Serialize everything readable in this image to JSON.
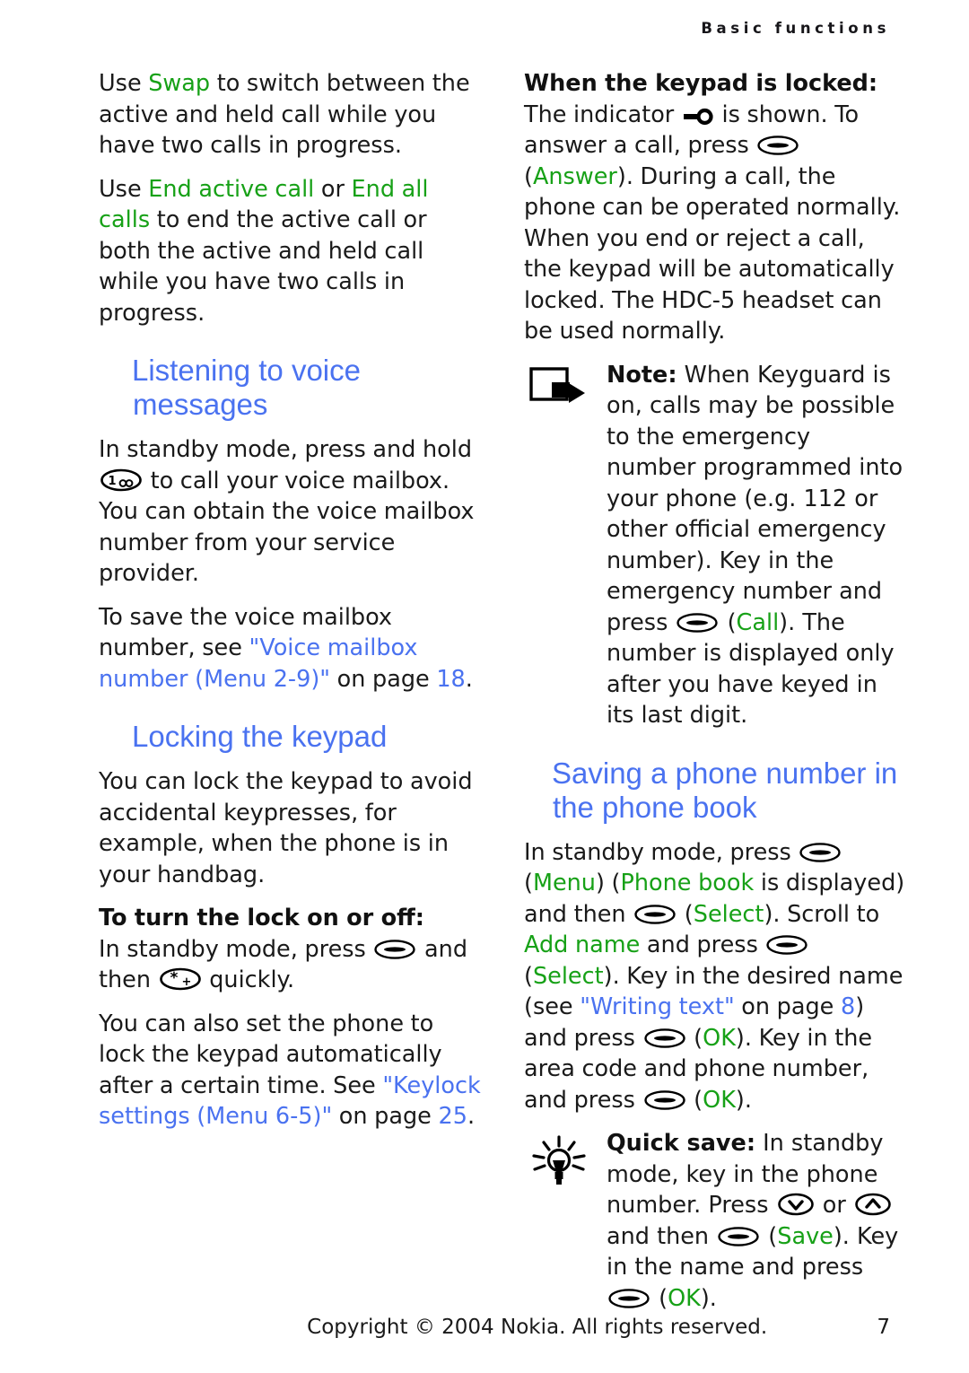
{
  "header": {
    "running_head": "Basic functions"
  },
  "left_column": {
    "para_swap": {
      "pre": "Use ",
      "cmd": "Swap",
      "post": " to switch between the active and held call while you have two calls in progress."
    },
    "para_end": {
      "pre": "Use ",
      "cmd1": "End active call",
      "mid": " or ",
      "cmd2": "End all calls",
      "post": " to end the active call or both the active and held call while you have two calls in progress."
    },
    "heading_voice": "Listening to voice messages",
    "para_voice_1_pre": "In standby mode, press and hold ",
    "key_one_icon": "key-1-voicemail-icon",
    "para_voice_1_post": " to call your voice mailbox. You can obtain the voice mailbox number from your service provider.",
    "para_voice_2_pre": "To save the voice mailbox number, see ",
    "para_voice_2_link": "\"Voice mailbox number (Menu 2-9)\"",
    "para_voice_2_mid": " on page ",
    "para_voice_2_page": "18",
    "para_voice_2_end": ".",
    "heading_lock": "Locking the keypad",
    "para_lock_intro": "You can lock the keypad to avoid accidental keypresses, for example, when the phone is in your handbag.",
    "subhead_lock": "To turn the lock on or off:",
    "para_lock_how_pre": "In standby mode, press ",
    "softkey_icon": "softkey-icon",
    "para_lock_how_mid": " and then ",
    "star_key_icon": "key-star-plus-icon",
    "para_lock_how_post": " quickly.",
    "para_lock_auto_pre": "You can also set the phone to lock the keypad automatically after a certain time. See ",
    "para_lock_auto_link": "\"Keylock settings (Menu 6-5)\"",
    "para_lock_auto_mid": " on page ",
    "para_lock_auto_page": "25",
    "para_lock_auto_end": "."
  },
  "right_column": {
    "subhead_locked": "When the keypad is locked:",
    "para_locked_a": "The indicator ",
    "keyguard_icon": "keyguard-indicator-icon",
    "para_locked_b": " is shown. To answer a call, press ",
    "para_locked_c": " (",
    "cmd_answer": "Answer",
    "para_locked_d": "). During a call, the phone can be operated normally. When you end or reject a call, the keypad will be automatically locked. The HDC-5 headset can be used normally.",
    "note": {
      "icon": "note-arrow-icon",
      "label": "Note:",
      "text_a": " When Keyguard is on, calls may be possible to the emergency number programmed into your phone (e.g. 112 or other official emergency number). Key in the emergency number and press ",
      "text_b": " (",
      "cmd_call": "Call",
      "text_c": "). The number is displayed only after you have keyed in its last digit."
    },
    "heading_saving": "Saving a phone number in the phone book",
    "para_save_a": "In standby mode, press ",
    "para_save_b": " (",
    "cmd_menu": "Menu",
    "para_save_c": ") (",
    "cmd_phonebook": "Phone book",
    "para_save_d": " is displayed) and then ",
    "para_save_e": " (",
    "cmd_select1": "Select",
    "para_save_f": "). Scroll to ",
    "cmd_addname": "Add name",
    "para_save_g": " and press ",
    "para_save_h": " (",
    "cmd_select2": "Select",
    "para_save_i": "). Key in the desired name (see ",
    "link_writing": "\"Writing text\"",
    "para_save_j": " on page ",
    "page_writing": "8",
    "para_save_k": ") and press ",
    "para_save_l": " (",
    "cmd_ok1": "OK",
    "para_save_m": "). Key in the area code and phone number, and press ",
    "para_save_n": " (",
    "cmd_ok2": "OK",
    "para_save_o": ").",
    "tip": {
      "icon": "lightbulb-tip-icon",
      "label": "Quick save:",
      "text_a": " In standby mode, key in the phone number. Press ",
      "scroll_down_icon": "scroll-down-key-icon",
      "text_b": " or ",
      "scroll_up_icon": "scroll-up-key-icon",
      "text_c": " and then ",
      "text_d": " (",
      "cmd_save": "Save",
      "text_e": "). Key in the name and press ",
      "text_f": " (",
      "cmd_ok": "OK",
      "text_g": ")."
    }
  },
  "footer": {
    "copyright": "Copyright © 2004 Nokia. All rights reserved.",
    "page_number": "7"
  },
  "colors": {
    "command_green": "#17a117",
    "heading_blue": "#4a72f0",
    "link_blue": "#4a72f0",
    "body_text": "#1a1a1a"
  }
}
